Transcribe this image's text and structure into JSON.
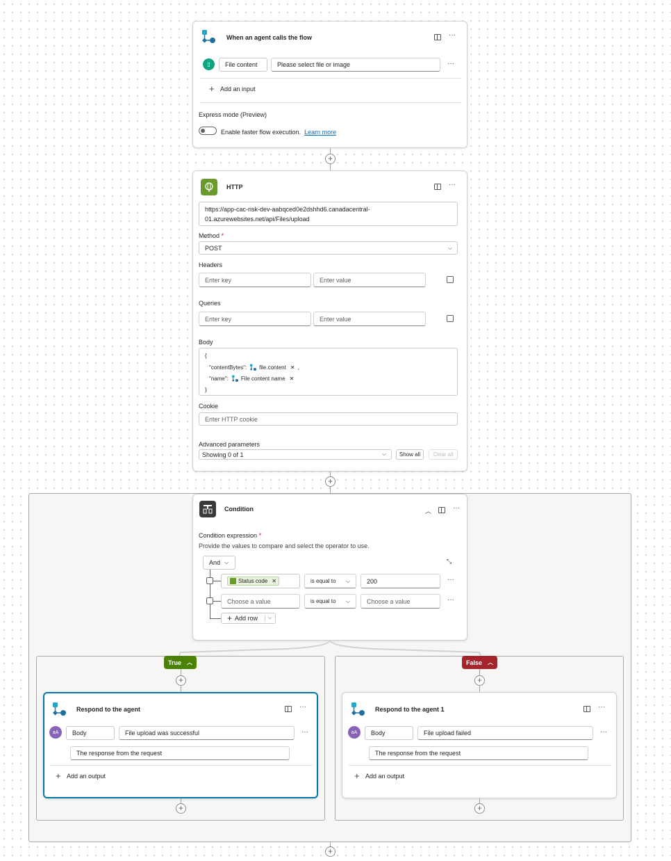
{
  "trigger": {
    "title": "When an agent calls the flow",
    "input_name": "File content",
    "input_placeholder": "Please select file or image",
    "add_input": "Add an input",
    "express_mode_label": "Express mode (Preview)",
    "toggle_label": "Enable faster flow execution.",
    "learn_more": "Learn more"
  },
  "http": {
    "title": "HTTP",
    "url_line1": "https://app-cac-risk-dev-aabqced0e2dshhd6.canadacentral-",
    "url_line2": "01.azurewebsites.net/api/Files/upload",
    "method_label": "Method",
    "method_value": "POST",
    "headers_label": "Headers",
    "queries_label": "Queries",
    "key_placeholder": "Enter key",
    "value_placeholder": "Enter value",
    "body_label": "Body",
    "body_open": "{",
    "body_key1": "\"contentBytes\":",
    "body_token1": "file.content",
    "body_comma": ",",
    "body_key2": "\"name\":",
    "body_token2": "File content name",
    "body_close": "}",
    "cookie_label": "Cookie",
    "cookie_placeholder": "Enter HTTP cookie",
    "advanced_label": "Advanced parameters",
    "advanced_value": "Showing 0 of 1",
    "show_all": "Show all",
    "clear_all": "Clear all"
  },
  "condition": {
    "title": "Condition",
    "expression_label": "Condition expression",
    "expression_help": "Provide the values to compare and select the operator to use.",
    "group_operator": "And",
    "rows": [
      {
        "left_token": "Status code",
        "operator": "is equal to",
        "right": "200"
      },
      {
        "left_placeholder": "Choose a value",
        "operator": "is equal to",
        "right_placeholder": "Choose a value"
      }
    ],
    "add_row": "Add row"
  },
  "branches": {
    "true_label": "True",
    "false_label": "False",
    "true_color": "#498205",
    "false_color": "#a4262c"
  },
  "respond_true": {
    "title": "Respond to the agent",
    "output_name": "Body",
    "output_value": "File upload was successful",
    "description": "The response from the request",
    "add_output": "Add an output"
  },
  "respond_false": {
    "title": "Respond to the agent 1",
    "output_name": "Body",
    "output_value": "File upload failed",
    "description": "The response from the request",
    "add_output": "Add an output"
  },
  "colors": {
    "accent": "#0f6cbd",
    "http_green": "#6b9a2c",
    "condition_dark": "#3b3a39",
    "selected_border": "#0078a8"
  }
}
